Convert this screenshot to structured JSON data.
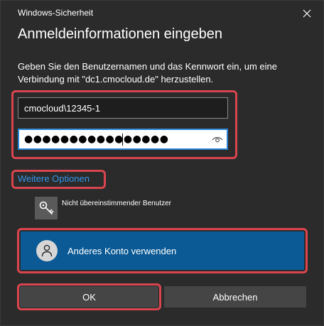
{
  "window": {
    "title": "Windows-Sicherheit"
  },
  "dialog": {
    "heading": "Anmeldeinformationen eingeben",
    "description": "Geben Sie den Benutzernamen und das Kennwort ein, um eine Verbindung mit \"dc1.cmocloud.de\" herzustellen."
  },
  "username": {
    "value": "cmocloud\\12345-1"
  },
  "password": {
    "masked_value": "●●●●●●●●●●●●●●●●"
  },
  "more_options": {
    "label": "Weitere Optionen"
  },
  "options": {
    "mismatched_user": "Nicht übereinstimmender Benutzer",
    "other_account": "Anderes Konto verwenden"
  },
  "buttons": {
    "ok": "OK",
    "cancel": "Abbrechen"
  },
  "colors": {
    "background": "#2b2b2b",
    "accent": "#0b5a95",
    "link": "#3794e8",
    "highlight": "#d9454f",
    "focus": "#2b84d6"
  }
}
